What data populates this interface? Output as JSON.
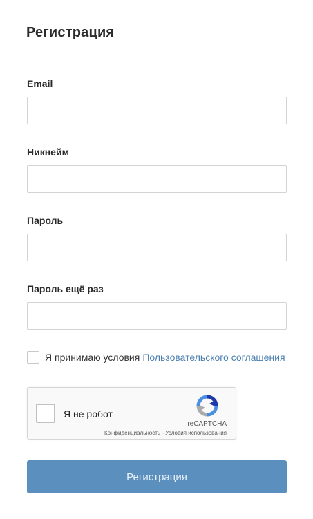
{
  "form": {
    "title": "Регистрация",
    "email_label": "Email",
    "email_value": "",
    "nickname_label": "Никнейм",
    "nickname_value": "",
    "password_label": "Пароль",
    "password_value": "",
    "password_repeat_label": "Пароль ещё раз",
    "password_repeat_value": "",
    "terms_text": "Я принимаю условия",
    "terms_link": "Пользовательского соглашения",
    "terms_checked": false,
    "submit_label": "Регистрация"
  },
  "captcha": {
    "checkbox_label": "Я не робот",
    "brand": "reCAPTCHA",
    "privacy": "Конфиденциальность",
    "separator": " - ",
    "terms": "Условия использования",
    "logo_icon": "recaptcha-logo-icon"
  },
  "colors": {
    "accent_button": "#5b8fbd",
    "link": "#4a7fb0",
    "input_border": "#d3d3d3"
  }
}
